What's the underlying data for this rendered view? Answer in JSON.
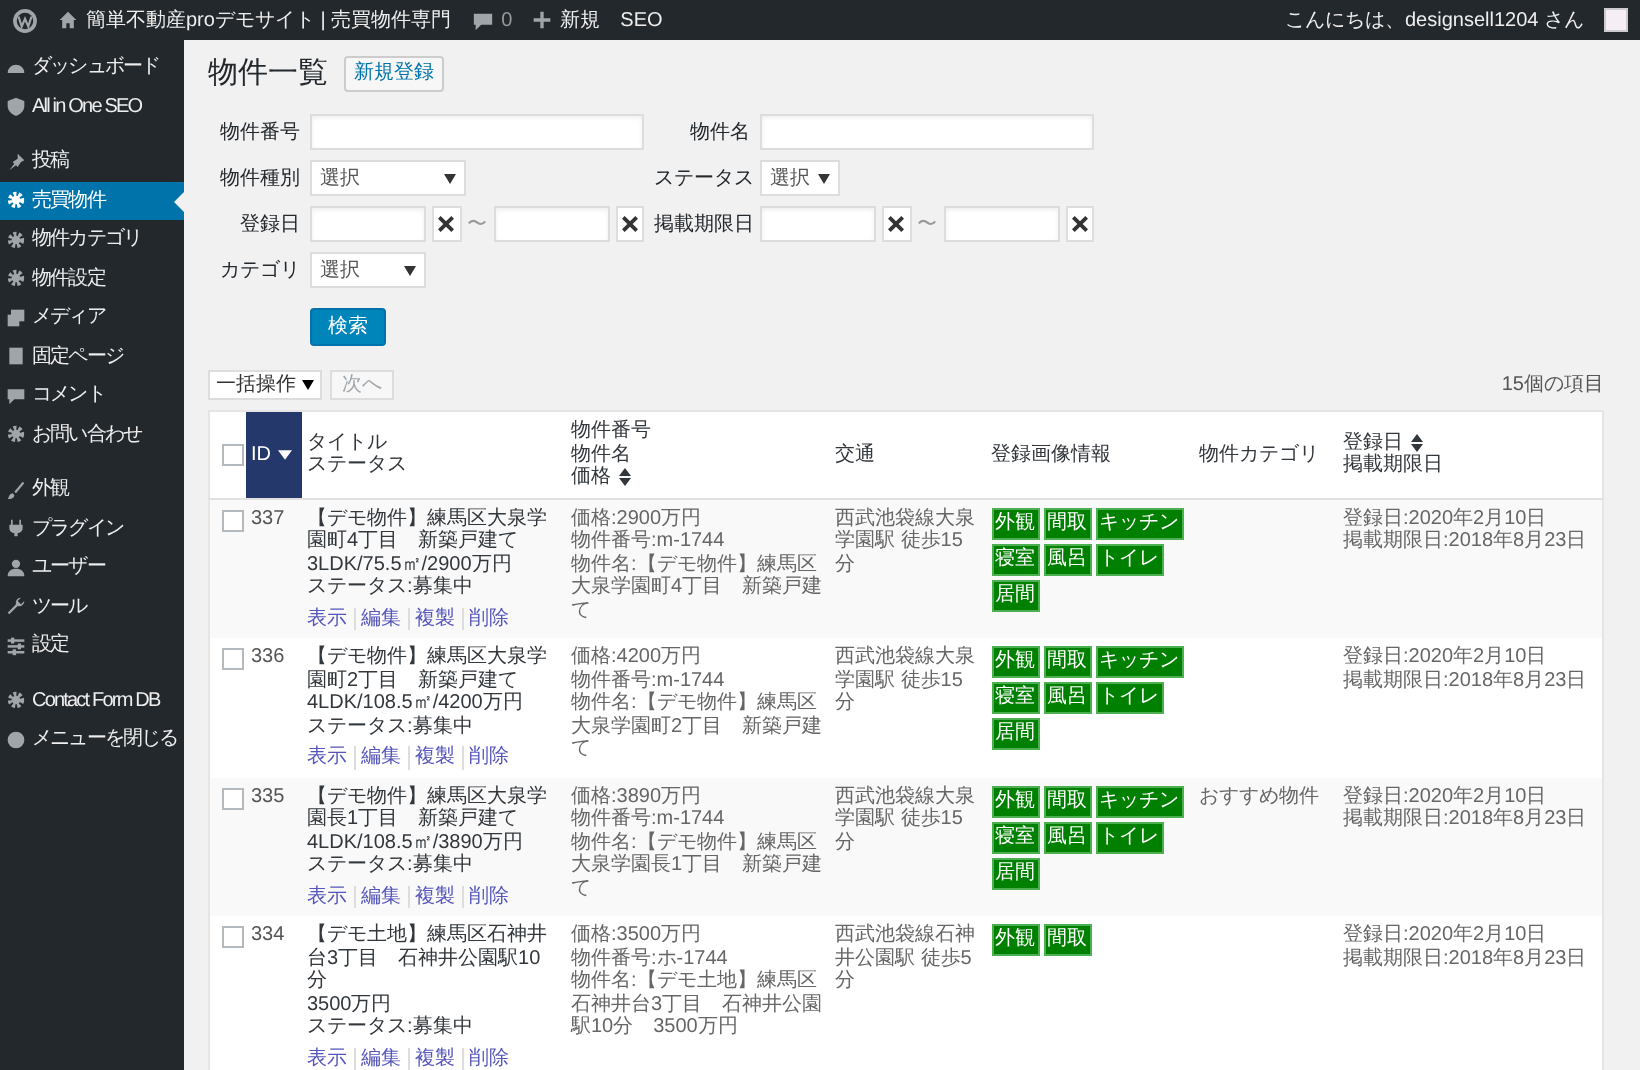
{
  "admin_bar": {
    "site_title": "簡単不動産proデモサイト | 売買物件専門",
    "comments": "0",
    "new": "新規",
    "seo": "SEO",
    "greeting": "こんにちは、designsell1204 さん"
  },
  "sidebar": {
    "groups": [
      [
        {
          "label": "ダッシュボード",
          "selected": false
        },
        {
          "label": "All in One SEO",
          "selected": false
        }
      ],
      [
        {
          "label": "投稿",
          "selected": false
        },
        {
          "label": "売買物件",
          "selected": true
        },
        {
          "label": "物件カテゴリ",
          "selected": false
        },
        {
          "label": "物件設定",
          "selected": false
        },
        {
          "label": "メディア",
          "selected": false
        },
        {
          "label": "固定ページ",
          "selected": false
        },
        {
          "label": "コメント",
          "selected": false
        },
        {
          "label": "お問い合わせ",
          "selected": false
        }
      ],
      [
        {
          "label": "外観",
          "selected": false
        },
        {
          "label": "プラグイン",
          "selected": false
        },
        {
          "label": "ユーザー",
          "selected": false
        },
        {
          "label": "ツール",
          "selected": false
        },
        {
          "label": "設定",
          "selected": false
        }
      ],
      [
        {
          "label": "Contact Form DB",
          "selected": false
        },
        {
          "label": "メニューを閉じる",
          "selected": false
        }
      ]
    ]
  },
  "page": {
    "title": "物件一覧",
    "add_new": "新規登録"
  },
  "filters": {
    "rows": [
      {
        "fields": [
          {
            "kind": "text",
            "label": "物件番号"
          },
          {
            "kind": "text",
            "label": "物件名"
          }
        ]
      },
      {
        "fields": [
          {
            "kind": "select",
            "label": "物件種別",
            "value": "選択"
          },
          {
            "kind": "select",
            "label": "ステータス",
            "value": "選択"
          }
        ]
      },
      {
        "fields": [
          {
            "kind": "daterange",
            "label": "登録日",
            "separator": "〜"
          },
          {
            "kind": "daterange",
            "label": "掲載期限日",
            "separator": "〜"
          }
        ]
      },
      {
        "fields": [
          {
            "kind": "select",
            "label": "カテゴリ",
            "value": "選択"
          }
        ]
      }
    ],
    "search_button": "検索"
  },
  "toolbar": {
    "bulk_action": "一括操作",
    "apply": "次へ",
    "apply_disabled": true,
    "count": "15個の項目"
  },
  "table": {
    "select_all_checked": false,
    "columns": [
      {
        "lines": [
          {
            "text": "ID",
            "sorted_descending": true
          }
        ],
        "sorted": true
      },
      {
        "lines": [
          {
            "text": "タイトル"
          },
          {
            "text": "ステータス"
          }
        ],
        "sorted": false
      },
      {
        "lines": [
          {
            "text": "物件番号"
          },
          {
            "text": "物件名"
          },
          {
            "text": "価格",
            "sortable": true
          }
        ],
        "sorted": false
      },
      {
        "lines": [
          {
            "text": "交通"
          }
        ],
        "sorted": false
      },
      {
        "lines": [
          {
            "text": "登録画像情報"
          }
        ],
        "sorted": false
      },
      {
        "lines": [
          {
            "text": "物件カテゴリ"
          }
        ],
        "sorted": false
      },
      {
        "lines": [
          {
            "text": "登録日",
            "sortable": true
          },
          {
            "text": "掲載期限日"
          }
        ],
        "sorted": false
      }
    ],
    "rows": [
      {
        "checked": false,
        "id": "337",
        "title": "【デモ物件】練馬区大泉学園町4丁目　新築戸建て",
        "summary": "3LDK/75.5㎡/2900万円",
        "status": "ステータス:募集中",
        "actions": [
          "表示",
          "編集",
          "複製",
          "削除"
        ],
        "info": [
          "価格:2900万円",
          "物件番号:m-1744",
          "物件名:【デモ物件】練馬区大泉学園町4丁目　新築戸建て"
        ],
        "access": "西武池袋線大泉学園駅 徒歩15分",
        "images": [
          "外観",
          "間取",
          "キッチン",
          "寝室",
          "風呂",
          "トイレ",
          "居間"
        ],
        "dates": [
          "登録日:2020年2月10日",
          "掲載期限日:2018年8月23日"
        ]
      },
      {
        "checked": false,
        "id": "336",
        "title": "【デモ物件】練馬区大泉学園町2丁目　新築戸建て",
        "summary": "4LDK/108.5㎡/4200万円",
        "status": "ステータス:募集中",
        "actions": [
          "表示",
          "編集",
          "複製",
          "削除"
        ],
        "info": [
          "価格:4200万円",
          "物件番号:m-1744",
          "物件名:【デモ物件】練馬区大泉学園町2丁目　新築戸建て"
        ],
        "access": "西武池袋線大泉学園駅 徒歩15分",
        "images": [
          "外観",
          "間取",
          "キッチン",
          "寝室",
          "風呂",
          "トイレ",
          "居間"
        ],
        "dates": [
          "登録日:2020年2月10日",
          "掲載期限日:2018年8月23日"
        ]
      },
      {
        "checked": false,
        "id": "335",
        "title": "【デモ物件】練馬区大泉学園長1丁目　新築戸建て",
        "summary": "4LDK/108.5㎡/3890万円",
        "status": "ステータス:募集中",
        "actions": [
          "表示",
          "編集",
          "複製",
          "削除"
        ],
        "info": [
          "価格:3890万円",
          "物件番号:m-1744",
          "物件名:【デモ物件】練馬区大泉学園長1丁目　新築戸建て"
        ],
        "access": "西武池袋線大泉学園駅 徒歩15分",
        "images": [
          "外観",
          "間取",
          "キッチン",
          "寝室",
          "風呂",
          "トイレ",
          "居間"
        ],
        "category": "おすすめ物件",
        "dates": [
          "登録日:2020年2月10日",
          "掲載期限日:2018年8月23日"
        ]
      },
      {
        "checked": false,
        "id": "334",
        "title": "【デモ土地】練馬区石神井台3丁目　石神井公園駅10分",
        "summary": "3500万円",
        "status": "ステータス:募集中",
        "actions": [
          "表示",
          "編集",
          "複製",
          "削除"
        ],
        "info": [
          "価格:3500万円",
          "物件番号:ホ-1744",
          "物件名:【デモ土地】練馬区石神井台3丁目　石神井公園駅10分　3500万円"
        ],
        "access": "西武池袋線石神井公園駅 徒歩5分",
        "images": [
          "外観",
          "間取"
        ],
        "dates": [
          "登録日:2020年2月10日",
          "掲載期限日:2018年8月23日"
        ]
      }
    ]
  }
}
